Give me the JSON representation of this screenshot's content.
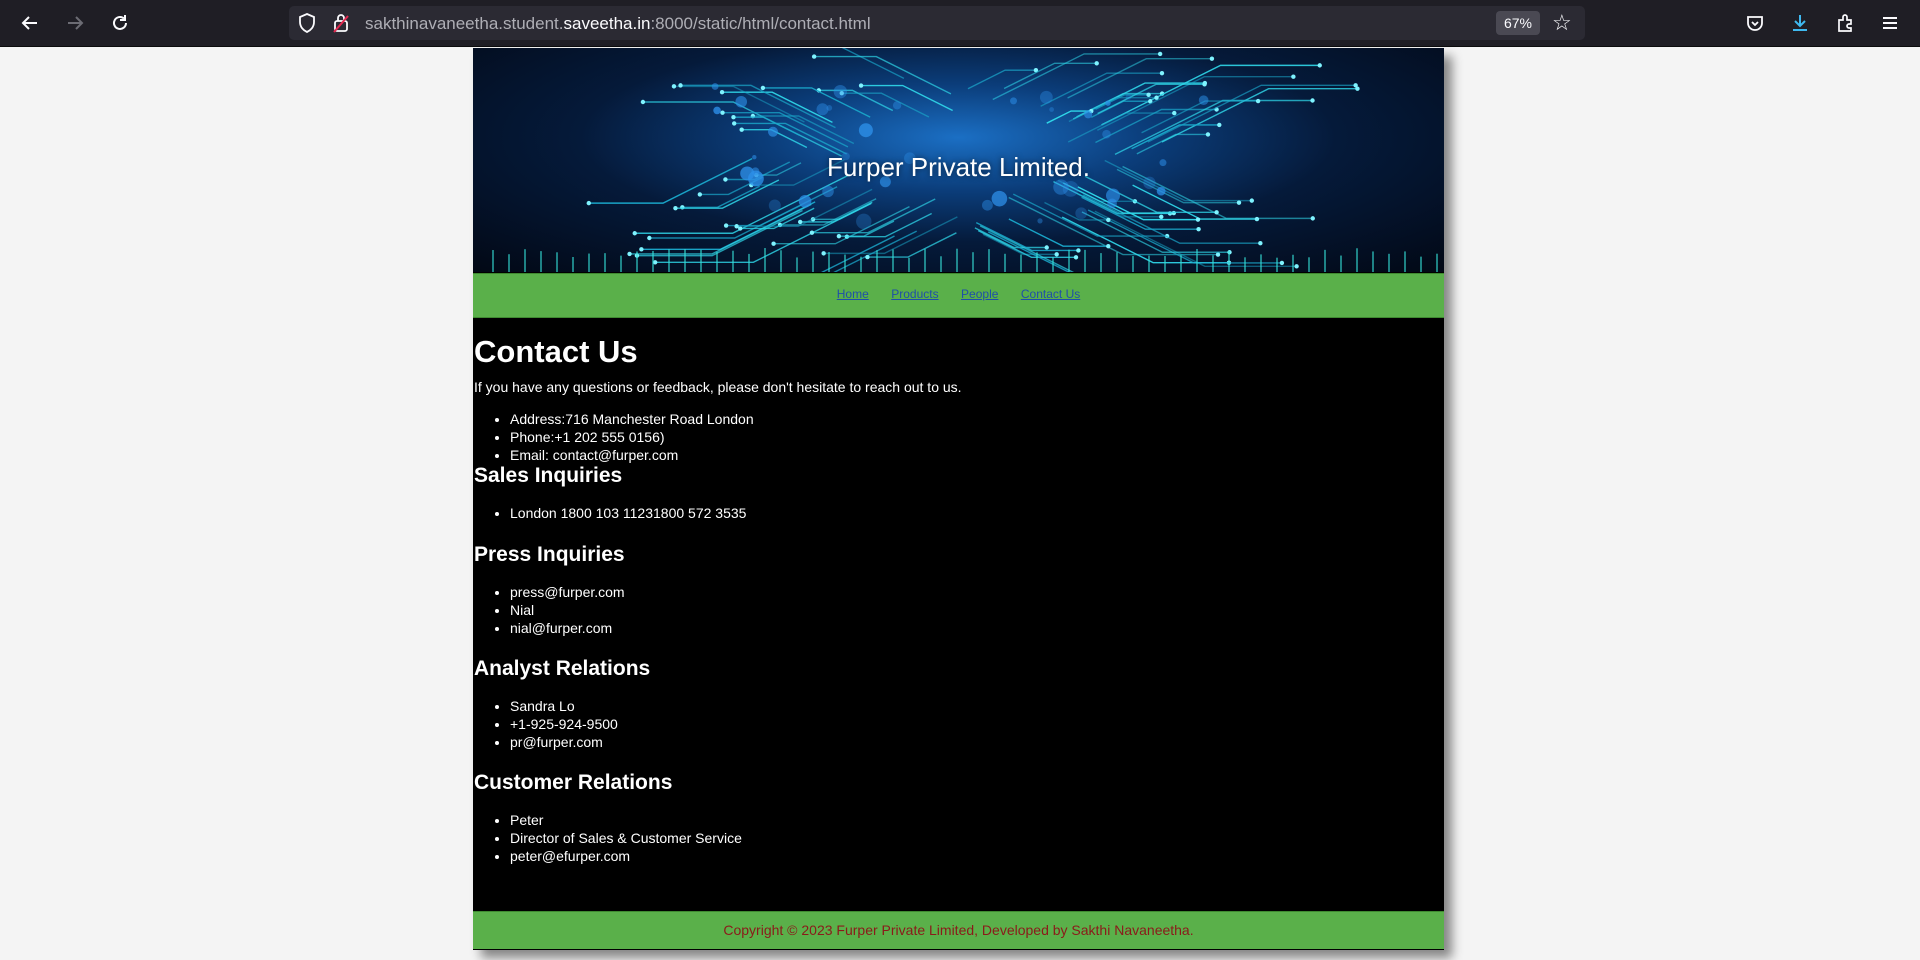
{
  "browser": {
    "url_prefix": "sakthinavaneetha.student.",
    "url_host": "saveetha.in",
    "url_suffix": ":8000/static/html/contact.html",
    "zoom": "67%"
  },
  "banner": {
    "title": "Furper Private Limited."
  },
  "nav": {
    "items": [
      "Home",
      "Products",
      "People",
      "Contact Us"
    ]
  },
  "contact": {
    "heading": "Contact Us",
    "intro": "If you have any questions or feedback, please don't hesitate to reach out to us.",
    "items": [
      "Address:716 Manchester Road London",
      "Phone:+1 202 555 0156)",
      "Email: contact@furper.com"
    ]
  },
  "sales": {
    "heading": "Sales Inquiries",
    "items": [
      "London 1800 103 11231800 572 3535"
    ]
  },
  "press": {
    "heading": "Press Inquiries",
    "items": [
      "press@furper.com",
      "Nial",
      "nial@furper.com"
    ]
  },
  "analyst": {
    "heading": "Analyst Relations",
    "items": [
      "Sandra Lo",
      "+1-925-924-9500",
      "pr@furper.com"
    ]
  },
  "customer": {
    "heading": "Customer Relations",
    "items": [
      "Peter",
      "Director of Sales & Customer Service",
      "peter@efurper.com"
    ]
  },
  "footer": {
    "text": "Copyright © 2023 Furper Private Limited, Developed by Sakthi Navaneetha."
  },
  "colors": {
    "nav_green": "#5ab04a",
    "footer_text": "#8b1a1a",
    "link": "#1f4fa8",
    "content_bg": "#000000"
  }
}
